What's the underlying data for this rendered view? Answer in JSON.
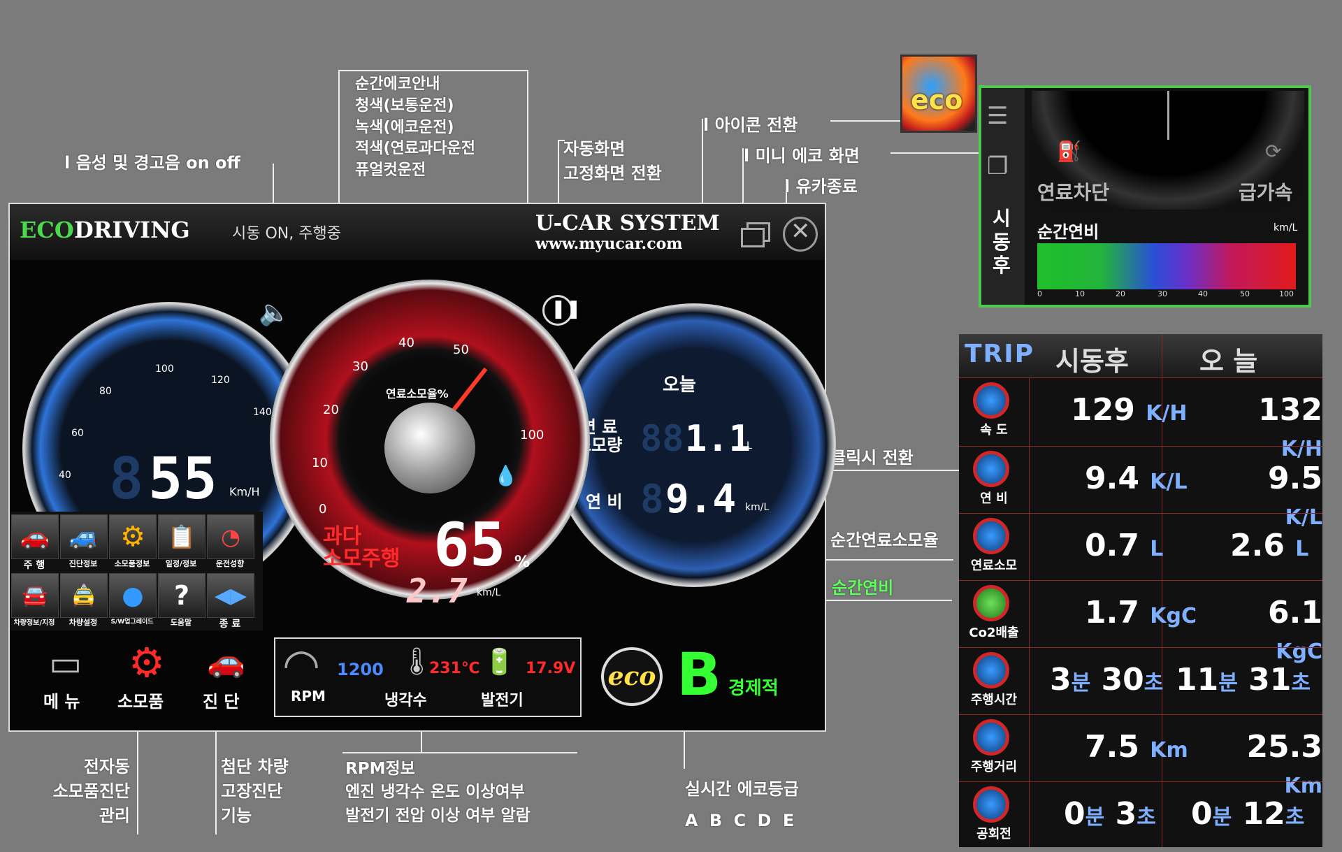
{
  "callouts": {
    "eco_guide": [
      "순간에코안내",
      "청색(보통운전)",
      "녹색(에코운전)",
      "적색(연료과다운전",
      "퓨얼컷운전"
    ],
    "sound": "l 음성 및 경고음 on off",
    "auto_screen": [
      "자동화면",
      "고정화면 전환"
    ],
    "icon_switch": "l 아이콘 전환",
    "mini_eco": "l 미니 에코 화면",
    "exit": "l 유카종료",
    "click_switch": "클릭시 전환",
    "inst_fuel_rate": "순간연료소모율",
    "inst_mileage": "순간연비",
    "consumables": [
      "전자동",
      "소모품진단",
      "관리"
    ],
    "diagnosis": [
      "첨단 차량",
      "고장진단",
      "기능"
    ],
    "rpm_info": [
      "RPM정보",
      "엔진 냉각수 온도 이상여부",
      "발전기 전압 이상 여부 알람"
    ],
    "eco_grade": [
      "실시간 에코등급",
      "A B C D E"
    ]
  },
  "main": {
    "eco": "ECO",
    "driving": "DRIVING",
    "status": "시동 ON, 주행중",
    "system": "U-CAR SYSTEM",
    "url": "www.myucar.com",
    "speed": "55",
    "speed_ghost": "8",
    "speed_unit": "Km/H",
    "speed_ticks": [
      "40",
      "60",
      "80",
      "100",
      "120",
      "140"
    ],
    "fuel_ticks": [
      "0",
      "10",
      "20",
      "30",
      "40",
      "50",
      "100"
    ],
    "fuel_title": "연료소모율%",
    "over": [
      "과다",
      "소모주행"
    ],
    "fuel_pct": "65",
    "pct": "%",
    "inst_km": "2.7",
    "inst_unit": "km/L",
    "today": "오늘",
    "fuel_used_label": [
      "연 료",
      "소모량"
    ],
    "fuel_used": "1.1",
    "fuel_used_ghost": "88",
    "fuel_used_unit": "L",
    "mileage_label": "연 비",
    "mileage": "9.4",
    "mileage_ghost": "8",
    "mileage_unit": "km/L",
    "menu_tiles": [
      "주 행",
      "진단정보",
      "소모품정보",
      "일정/정보",
      "운전성향",
      "차량정보/지정",
      "차량설정",
      "S/W업그레이드",
      "도움말",
      "종 료"
    ],
    "bottom_btns": [
      "메 뉴",
      "소모품",
      "진 단"
    ],
    "rpm_label": "RPM",
    "rpm": "1200",
    "coolant_label": "냉각수",
    "coolant": "231℃",
    "gen_label": "발전기",
    "gen": "17.9V",
    "eco_badge": "eco",
    "grade": "B",
    "grade_text": "경제적"
  },
  "mini": {
    "eco_icon": "eco",
    "fuel_cut": "연료차단",
    "rapid": "급가속",
    "side": [
      "시",
      "동",
      "후"
    ],
    "title": "순간연비",
    "unit": "km/L",
    "ticks": [
      "0",
      "10",
      "20",
      "30",
      "40",
      "50",
      "100"
    ]
  },
  "trip": {
    "title": "TRIP",
    "col1": "시동후",
    "col2": "오 늘",
    "rows": [
      {
        "label": "속 도",
        "v1": "129",
        "u1": "K/H",
        "v2": "132",
        "u2": "K/H"
      },
      {
        "label": "연 비",
        "v1": "9.4",
        "u1": "K/L",
        "v2": "9.5",
        "u2": "K/L"
      },
      {
        "label": "연료소모",
        "v1": "0.7",
        "u1": "L",
        "v2": "2.6",
        "u2": "L"
      },
      {
        "label": "Co2배출",
        "v1": "1.7",
        "u1": "KgC",
        "v2": "6.1",
        "u2": "KgC"
      },
      {
        "label": "주행시간",
        "v1": "3",
        "m1": "분",
        "s1": "30",
        "t1": "초",
        "v2": "11",
        "m2": "분",
        "s2": "31",
        "t2": "초"
      },
      {
        "label": "주행거리",
        "v1": "7.5",
        "u1": "Km",
        "v2": "25.3",
        "u2": "Km"
      },
      {
        "label": "공회전",
        "v1": "0",
        "m1": "분",
        "s1": "3",
        "t1": "초",
        "v2": "0",
        "m2": "분",
        "s2": "12",
        "t2": "초"
      }
    ]
  },
  "colors": {
    "speed_blue": "#2f74d8",
    "fuel_red": "#c1121f",
    "eco_green": "#33ff33",
    "trip_blue": "#7fb0ff",
    "mini_border": "#4ec94e"
  }
}
